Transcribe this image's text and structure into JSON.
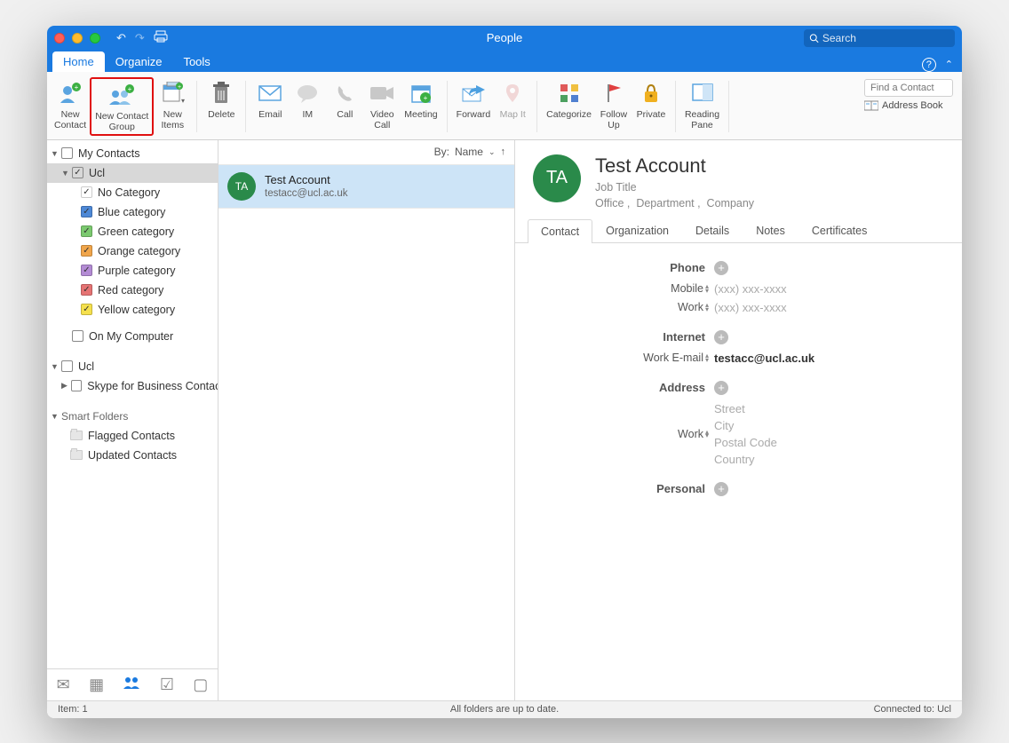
{
  "titlebar": {
    "title": "People",
    "search_placeholder": "Search"
  },
  "tabs": {
    "home": "Home",
    "organize": "Organize",
    "tools": "Tools"
  },
  "ribbon": {
    "new_contact": "New\nContact",
    "new_contact_group": "New Contact\nGroup",
    "new_items": "New\nItems",
    "delete": "Delete",
    "email": "Email",
    "im": "IM",
    "call": "Call",
    "video_call": "Video\nCall",
    "meeting": "Meeting",
    "forward": "Forward",
    "map_it": "Map It",
    "categorize": "Categorize",
    "follow_up": "Follow\nUp",
    "private": "Private",
    "reading_pane": "Reading\nPane",
    "find_contact_placeholder": "Find a Contact",
    "address_book": "Address Book"
  },
  "sidebar": {
    "my_contacts": "My Contacts",
    "ucl": "Ucl",
    "categories": [
      {
        "label": "No Category",
        "color": "#ffffff"
      },
      {
        "label": "Blue category",
        "color": "#4d88d6"
      },
      {
        "label": "Green category",
        "color": "#7bc96f"
      },
      {
        "label": "Orange category",
        "color": "#f0a54a"
      },
      {
        "label": "Purple category",
        "color": "#b38bd4"
      },
      {
        "label": "Red category",
        "color": "#e57373"
      },
      {
        "label": "Yellow category",
        "color": "#f5e04d"
      }
    ],
    "on_my_computer": "On My Computer",
    "ucl2": "Ucl",
    "skype": "Skype for Business Contacts",
    "smart_folders": "Smart Folders",
    "flagged": "Flagged Contacts",
    "updated": "Updated Contacts"
  },
  "list": {
    "sort_by": "By:",
    "sort_field": "Name",
    "contact_initials": "TA",
    "contact_name": "Test Account",
    "contact_email": "testacc@ucl.ac.uk"
  },
  "detail": {
    "initials": "TA",
    "name": "Test  Account",
    "job_title": "Job Title",
    "office": "Office",
    "department": "Department",
    "company": "Company",
    "tabs": {
      "contact": "Contact",
      "organization": "Organization",
      "details": "Details",
      "notes": "Notes",
      "certificates": "Certificates"
    },
    "phone_section": "Phone",
    "mobile_label": "Mobile",
    "mobile_placeholder": "(xxx) xxx-xxxx",
    "work_phone_label": "Work",
    "work_phone_placeholder": "(xxx) xxx-xxxx",
    "internet_section": "Internet",
    "work_email_label": "Work E-mail",
    "work_email_value": "testacc@ucl.ac.uk",
    "address_section": "Address",
    "work_addr_label": "Work",
    "street": "Street",
    "city": "City",
    "postal": "Postal Code",
    "country": "Country",
    "personal_section": "Personal"
  },
  "statusbar": {
    "item_count": "Item: 1",
    "sync": "All folders are up to date.",
    "conn": "Connected to: Ucl"
  }
}
